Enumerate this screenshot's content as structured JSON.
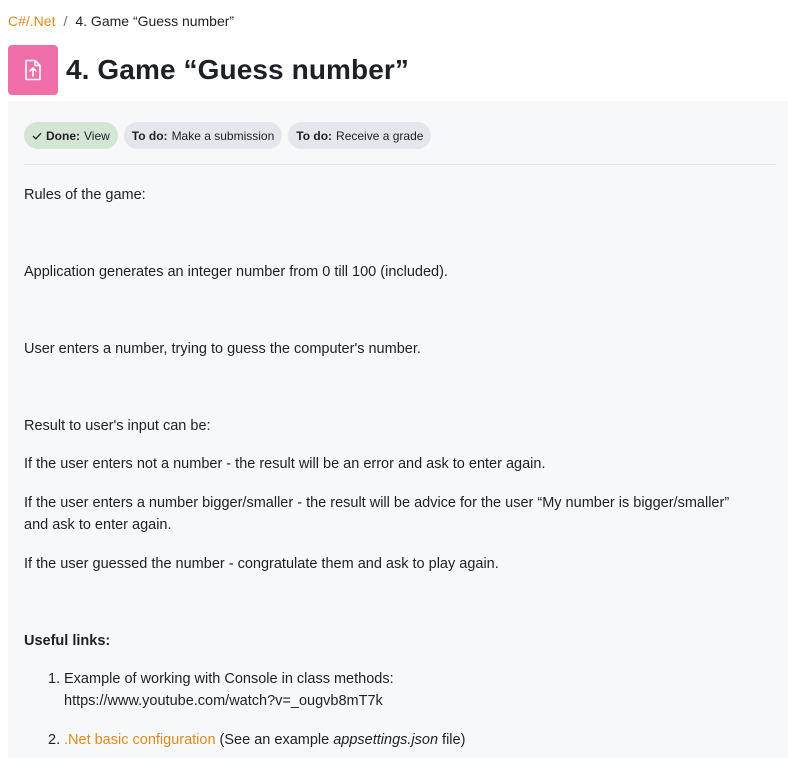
{
  "breadcrumb": {
    "course": "C#/.Net",
    "separator": "/",
    "current": "4. Game “Guess number”"
  },
  "header": {
    "title": "4. Game “Guess number”",
    "icon": "assignment-upload-icon",
    "icon_color": "#f06ea9"
  },
  "completion": {
    "done": {
      "prefix": "Done:",
      "label": "View"
    },
    "todo1": {
      "prefix": "To do:",
      "label": "Make a submission"
    },
    "todo2": {
      "prefix": "To do:",
      "label": "Receive a grade"
    }
  },
  "description": {
    "rules_heading": "Rules of the game:",
    "p1": "Application generates an integer number from 0 till 100 (included).",
    "p2": "User enters a number, trying to guess the computer's number.",
    "p3": "Result to user's input can be:",
    "p4": "If the user enters not a number - the result will be an error and ask to enter again.",
    "p5_line1": "If the user enters a number bigger/smaller - the result will be advice for the user “My number is bigger/smaller”",
    "p5_line2": "and ask to enter again.",
    "p6": "If the user guessed the number - congratulate them and ask to play again.",
    "links_heading": "Useful links:",
    "links": [
      {
        "num": "1.",
        "line1": "Example of working with Console in class methods:",
        "line2": "https://www.youtube.com/watch?v=_ougvb8mT7k"
      },
      {
        "num": "2.",
        "link_text": ".Net basic configuration",
        "after1": " (See an example ",
        "em": "appsettings.json",
        "after2": " file)"
      }
    ]
  },
  "colors": {
    "accent": "#e08a1e",
    "done_badge": "#d4e6d3",
    "todo_badge": "#e3e6ea",
    "content_bg": "#f7f8fa"
  }
}
